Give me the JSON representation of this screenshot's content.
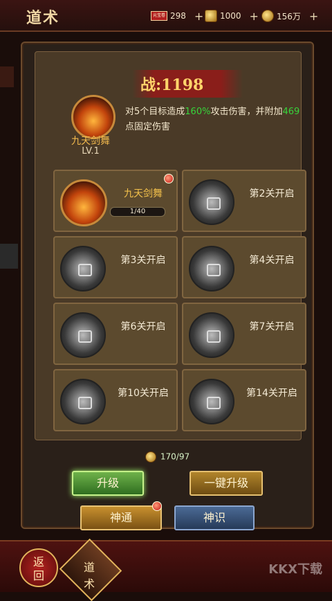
{
  "header": {
    "title": "道术",
    "resources": [
      {
        "icon": "ticket-icon",
        "label": "元宝卷",
        "value": "298"
      },
      {
        "icon": "gold-ingot-icon",
        "value": "1000"
      },
      {
        "icon": "coin-icon",
        "value": "156万"
      }
    ]
  },
  "skill": {
    "power_prefix": "战:",
    "power_value": "1198",
    "name": "九天剑舞",
    "level": "LV.1",
    "desc_part1": "对5个目标造成",
    "desc_pct": "160%",
    "desc_part2": "攻击伤害，并附加",
    "desc_bonus": "469",
    "desc_part3": "点固定伤害"
  },
  "cards": [
    {
      "label": "九天剑舞",
      "progress": "1/40",
      "active": true
    },
    {
      "label": "第2关开启"
    },
    {
      "label": "第3关开启"
    },
    {
      "label": "第4关开启"
    },
    {
      "label": "第6关开启"
    },
    {
      "label": "第7关开启"
    },
    {
      "label": "第10关开启"
    },
    {
      "label": "第14关开启"
    }
  ],
  "cost": {
    "value": "170/97"
  },
  "buttons": {
    "upgrade": "升级",
    "one_click": "一键升级",
    "shentong": "神通",
    "shenshi": "神识"
  },
  "bottom": {
    "back_line1": "返",
    "back_line2": "回",
    "dao_line1": "道",
    "dao_line2": "术",
    "watermark": "KKX下载"
  }
}
